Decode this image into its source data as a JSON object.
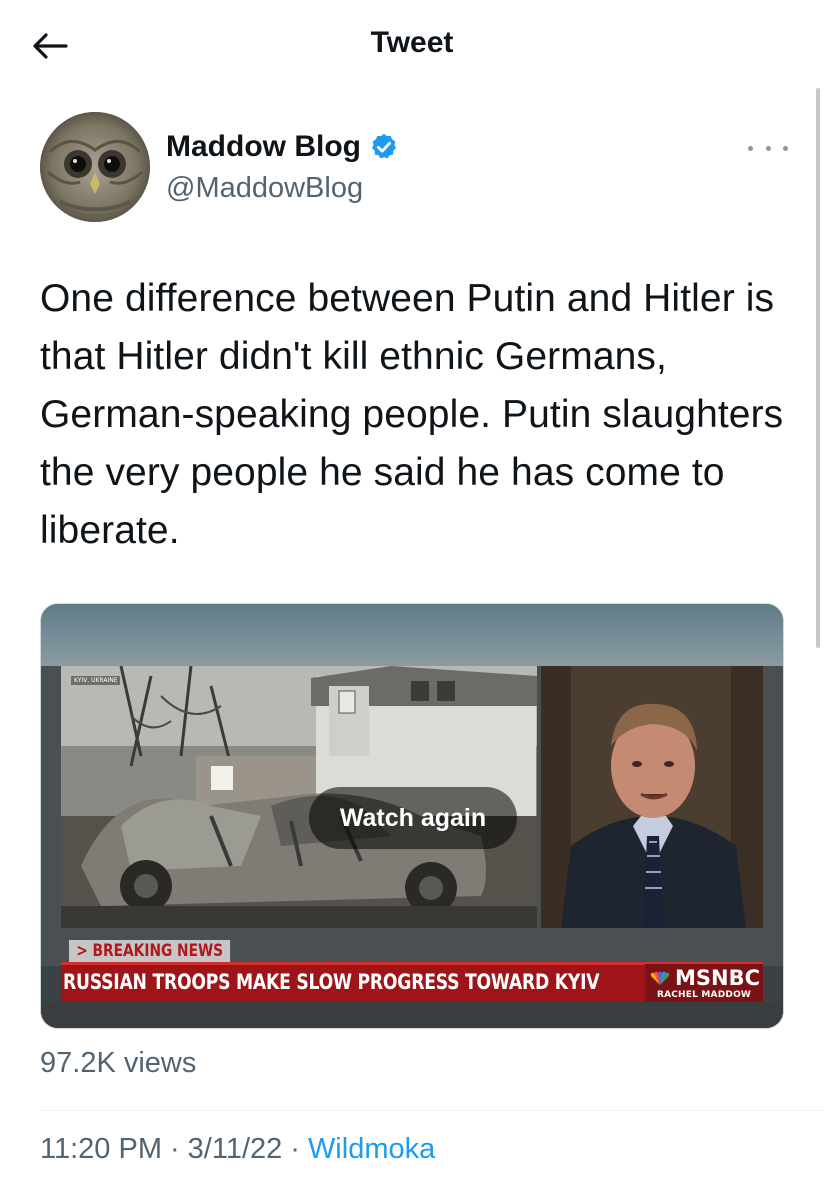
{
  "header": {
    "title": "Tweet"
  },
  "author": {
    "name": "Maddow Blog",
    "handle": "@MaddowBlog",
    "verified": true
  },
  "tweet": {
    "text": "One difference between Putin and Hitler is that Hitler didn't kill ethnic Germans, German-speaking people. Putin slaughters the very people he said he has come to liberate."
  },
  "media": {
    "overlay_label": "Watch again",
    "location_tag": "KYIV, UKRAINE",
    "breaking_label": "> BREAKING NEWS",
    "headline": "RUSSIAN TROOPS MAKE SLOW PROGRESS TOWARD KYIV",
    "network": "MSNBC",
    "show": "RACHEL MADDOW"
  },
  "stats": {
    "views": "97.2K views"
  },
  "meta": {
    "time": "11:20 PM",
    "separator": "·",
    "date": "3/11/22",
    "source": "Wildmoka"
  },
  "colors": {
    "link": "#1d9bf0",
    "secondary_text": "#536471",
    "breaking_red": "#9f1418"
  }
}
